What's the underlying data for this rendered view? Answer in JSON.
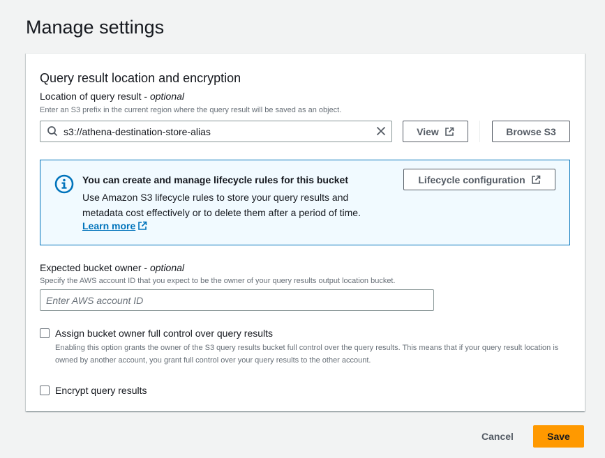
{
  "page": {
    "title": "Manage settings"
  },
  "section": {
    "title": "Query result location and encryption",
    "location": {
      "label": "Location of query result - ",
      "label_optional": "optional",
      "description": "Enter an S3 prefix in the current region where the query result will be saved as an object.",
      "value": "s3://athena-destination-store-alias"
    },
    "view_button": "View",
    "browse_button": "Browse S3"
  },
  "info": {
    "title": "You can create and manage lifecycle rules for this bucket",
    "body": "Use Amazon S3 lifecycle rules to store your query results and metadata cost effectively or to delete them after a period of time.",
    "link": "Learn more",
    "button": "Lifecycle configuration"
  },
  "owner": {
    "label": "Expected bucket owner - ",
    "label_optional": "optional",
    "description": "Specify the AWS account ID that you expect to be the owner of your query results output location bucket.",
    "placeholder": "Enter AWS account ID"
  },
  "full_control": {
    "label": "Assign bucket owner full control over query results",
    "description": "Enabling this option grants the owner of the S3 query results bucket full control over the query results. This means that if your query result location is owned by another account, you grant full control over your query results to the other account.",
    "checked": false
  },
  "encrypt": {
    "label": "Encrypt query results",
    "checked": false
  },
  "footer": {
    "cancel": "Cancel",
    "save": "Save"
  },
  "colors": {
    "accent": "#0073bb",
    "primary": "#ff9900",
    "info_bg": "#f1faff"
  }
}
